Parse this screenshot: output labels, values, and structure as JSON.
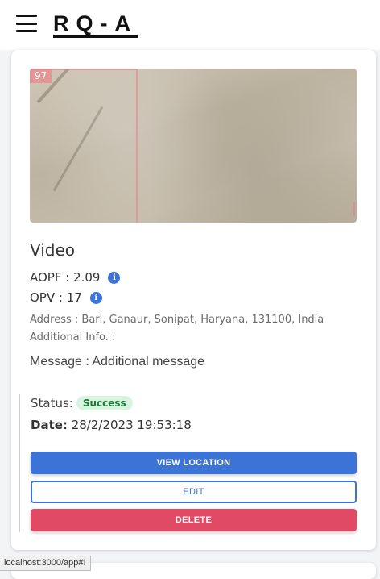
{
  "header": {
    "logo": "RQ-A",
    "menu_icon": "hamburger-menu-icon"
  },
  "card": {
    "media_label": "97",
    "title": "Video",
    "aopf_label": "AOPF : 2.09",
    "opv_label": "OPV : 17",
    "address": "Address : Bari, Ganaur, Sonipat, Haryana, 131100, India",
    "additional_info": "Additional Info. :",
    "message": "Message : Additional message",
    "status_label": "Status:",
    "status_value": "Success",
    "date_label": "Date:",
    "date_value": "28/2/2023 19:53:18",
    "buttons": {
      "view_location": "VIEW LOCATION",
      "edit": "EDIT",
      "delete": "DELETE"
    }
  },
  "status_url": "localhost:3000/app#!",
  "colors": {
    "primary": "#3b73d6",
    "danger": "#e04a64",
    "success_bg": "#d8f4df",
    "success_text": "#1a7a38"
  }
}
